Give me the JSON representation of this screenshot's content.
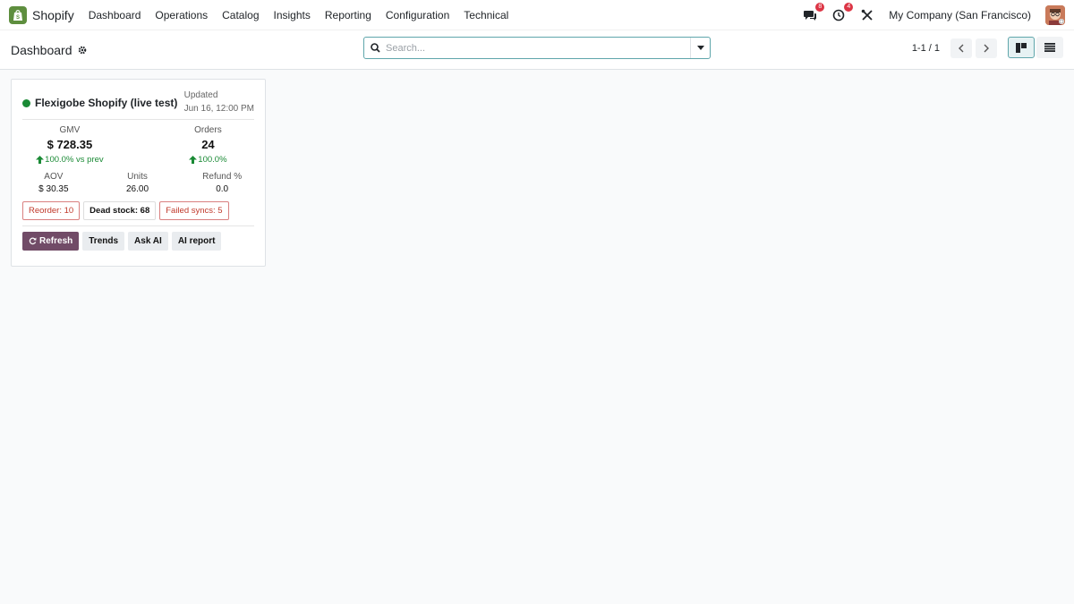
{
  "app": {
    "name": "Shopify"
  },
  "menu": [
    "Dashboard",
    "Operations",
    "Catalog",
    "Insights",
    "Reporting",
    "Configuration",
    "Technical"
  ],
  "systray": {
    "messages_count": "8",
    "activities_count": "4",
    "company": "My Company (San Francisco)"
  },
  "control": {
    "title": "Dashboard",
    "search_placeholder": "Search...",
    "pager": "1-1 / 1"
  },
  "card": {
    "title": "Flexigobe Shopify (live test)",
    "updated_label": "Updated",
    "updated_value": "Jun 16, 12:00 PM",
    "gmv_label": "GMV",
    "gmv_value": "$ 728.35",
    "gmv_delta": "100.0% vs prev",
    "orders_label": "Orders",
    "orders_value": "24",
    "orders_delta": "100.0%",
    "aov_label": "AOV",
    "aov_value": "$ 30.35",
    "units_label": "Units",
    "units_value": "26.00",
    "refund_label": "Refund %",
    "refund_value": "0.0",
    "chips": {
      "reorder": "Reorder: 10",
      "dead_stock": "Dead stock: 68",
      "failed_syncs": "Failed syncs: 5"
    },
    "actions": {
      "refresh": "Refresh",
      "trends": "Trends",
      "ask_ai": "Ask AI",
      "ai_report": "AI report"
    }
  },
  "colors": {
    "accent": "#714b67",
    "teal": "#5fa6ab",
    "success": "#1a8a35",
    "danger": "#dc3545"
  }
}
